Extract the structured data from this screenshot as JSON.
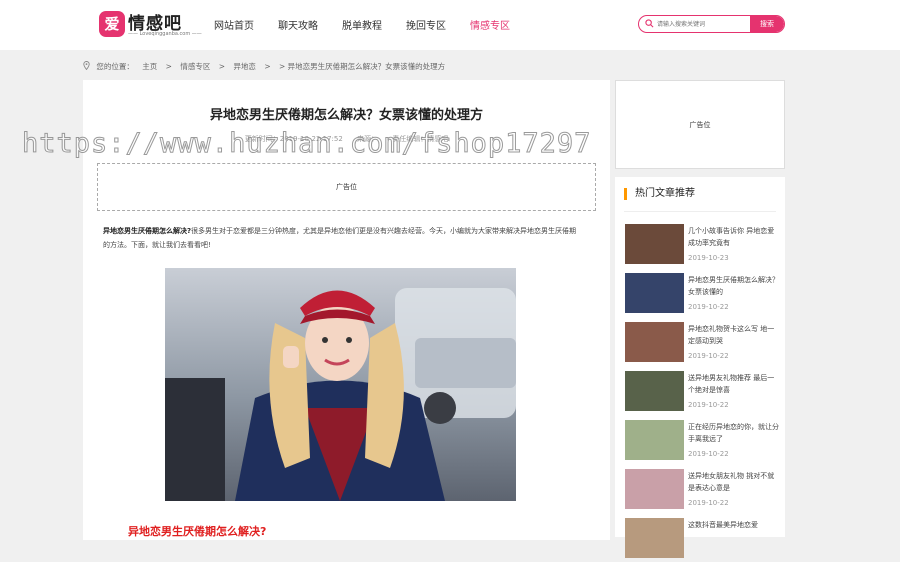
{
  "header": {
    "logo_mark": "爱",
    "logo_text": "情感吧",
    "logo_sub": "—— Loveqingganba.com ——",
    "nav": [
      "网站首页",
      "聊天攻略",
      "脱单教程",
      "挽回专区",
      "情感专区"
    ],
    "search_placeholder": "请输入搜索关键词",
    "search_button": "搜索",
    "accent": "#e5336f"
  },
  "breadcrumb": {
    "location_label": "您的位置：",
    "items": [
      "主页",
      ">",
      "情感专区",
      ">",
      "异地恋",
      ">",
      "> 异地恋男生厌倦期怎么解决？女票该懂的处理方"
    ]
  },
  "article": {
    "title": "异地恋男生厌倦期怎么解决？女票该懂的处理方",
    "meta_time": "更新时间：2019-10-22 17:52",
    "meta_author": "来源：",
    "meta_editor": "责任编辑：情感吧",
    "ad_label": "广告位",
    "intro_bold": "异地恋男生厌倦期怎么解决?",
    "intro_text": "很多男生对于恋爱都是三分钟热度，尤其是异地恋他们更是没有兴趣去经营。今天，小编就为大家带来解决异地恋男生厌倦期的方法。下面，就让我们去看看吧!",
    "subhead": "异地恋男生厌倦期怎么解决?"
  },
  "watermark": "https://www.huzhan.com/fshop17297",
  "sidebar": {
    "ad_label": "广告位",
    "hot_title": "热门文章推荐",
    "items": [
      {
        "title": "几个小故事告诉你 异地恋爱成功率究竟有",
        "date": "2019-10-23",
        "color": "#6b4a3a"
      },
      {
        "title": "异地恋男生厌倦期怎么解决？女票该懂的",
        "date": "2019-10-22",
        "color": "#35446a"
      },
      {
        "title": "异地恋礼物贺卡这么写 地一定感动到哭",
        "date": "2019-10-22",
        "color": "#8a5a4a"
      },
      {
        "title": "送异地男友礼物推荐 最后一个绝对是惊喜",
        "date": "2019-10-22",
        "color": "#58624a"
      },
      {
        "title": "正在经历异地恋的你，就让分手离我远了",
        "date": "2019-10-22",
        "color": "#9fb08a"
      },
      {
        "title": "送异地女朋友礼物 挑对不就是表达心意是",
        "date": "2019-10-22",
        "color": "#c9a0a8"
      },
      {
        "title": "这数抖音最美异地恋爱",
        "date": "",
        "color": "#b79a7e"
      }
    ]
  }
}
